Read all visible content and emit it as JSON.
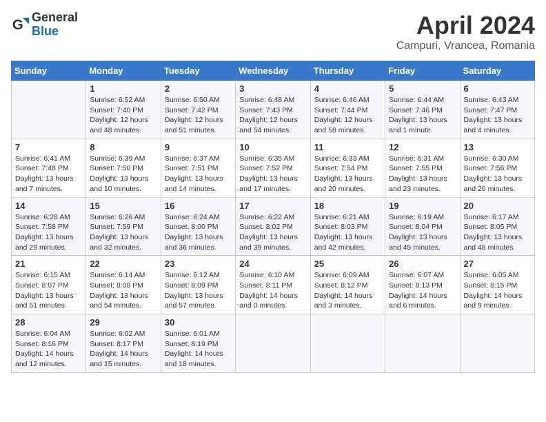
{
  "header": {
    "logo_general": "General",
    "logo_blue": "Blue",
    "month_title": "April 2024",
    "subtitle": "Campuri, Vrancea, Romania"
  },
  "days_of_week": [
    "Sunday",
    "Monday",
    "Tuesday",
    "Wednesday",
    "Thursday",
    "Friday",
    "Saturday"
  ],
  "weeks": [
    [
      {
        "day": "",
        "info": ""
      },
      {
        "day": "1",
        "info": "Sunrise: 6:52 AM\nSunset: 7:40 PM\nDaylight: 12 hours\nand 48 minutes."
      },
      {
        "day": "2",
        "info": "Sunrise: 6:50 AM\nSunset: 7:42 PM\nDaylight: 12 hours\nand 51 minutes."
      },
      {
        "day": "3",
        "info": "Sunrise: 6:48 AM\nSunset: 7:43 PM\nDaylight: 12 hours\nand 54 minutes."
      },
      {
        "day": "4",
        "info": "Sunrise: 6:46 AM\nSunset: 7:44 PM\nDaylight: 12 hours\nand 58 minutes."
      },
      {
        "day": "5",
        "info": "Sunrise: 6:44 AM\nSunset: 7:46 PM\nDaylight: 13 hours\nand 1 minute."
      },
      {
        "day": "6",
        "info": "Sunrise: 6:43 AM\nSunset: 7:47 PM\nDaylight: 13 hours\nand 4 minutes."
      }
    ],
    [
      {
        "day": "7",
        "info": "Sunrise: 6:41 AM\nSunset: 7:48 PM\nDaylight: 13 hours\nand 7 minutes."
      },
      {
        "day": "8",
        "info": "Sunrise: 6:39 AM\nSunset: 7:50 PM\nDaylight: 13 hours\nand 10 minutes."
      },
      {
        "day": "9",
        "info": "Sunrise: 6:37 AM\nSunset: 7:51 PM\nDaylight: 13 hours\nand 14 minutes."
      },
      {
        "day": "10",
        "info": "Sunrise: 6:35 AM\nSunset: 7:52 PM\nDaylight: 13 hours\nand 17 minutes."
      },
      {
        "day": "11",
        "info": "Sunrise: 6:33 AM\nSunset: 7:54 PM\nDaylight: 13 hours\nand 20 minutes."
      },
      {
        "day": "12",
        "info": "Sunrise: 6:31 AM\nSunset: 7:55 PM\nDaylight: 13 hours\nand 23 minutes."
      },
      {
        "day": "13",
        "info": "Sunrise: 6:30 AM\nSunset: 7:56 PM\nDaylight: 13 hours\nand 26 minutes."
      }
    ],
    [
      {
        "day": "14",
        "info": "Sunrise: 6:28 AM\nSunset: 7:58 PM\nDaylight: 13 hours\nand 29 minutes."
      },
      {
        "day": "15",
        "info": "Sunrise: 6:26 AM\nSunset: 7:59 PM\nDaylight: 13 hours\nand 32 minutes."
      },
      {
        "day": "16",
        "info": "Sunrise: 6:24 AM\nSunset: 8:00 PM\nDaylight: 13 hours\nand 36 minutes."
      },
      {
        "day": "17",
        "info": "Sunrise: 6:22 AM\nSunset: 8:02 PM\nDaylight: 13 hours\nand 39 minutes."
      },
      {
        "day": "18",
        "info": "Sunrise: 6:21 AM\nSunset: 8:03 PM\nDaylight: 13 hours\nand 42 minutes."
      },
      {
        "day": "19",
        "info": "Sunrise: 6:19 AM\nSunset: 8:04 PM\nDaylight: 13 hours\nand 45 minutes."
      },
      {
        "day": "20",
        "info": "Sunrise: 6:17 AM\nSunset: 8:05 PM\nDaylight: 13 hours\nand 48 minutes."
      }
    ],
    [
      {
        "day": "21",
        "info": "Sunrise: 6:15 AM\nSunset: 8:07 PM\nDaylight: 13 hours\nand 51 minutes."
      },
      {
        "day": "22",
        "info": "Sunrise: 6:14 AM\nSunset: 8:08 PM\nDaylight: 13 hours\nand 54 minutes."
      },
      {
        "day": "23",
        "info": "Sunrise: 6:12 AM\nSunset: 8:09 PM\nDaylight: 13 hours\nand 57 minutes."
      },
      {
        "day": "24",
        "info": "Sunrise: 6:10 AM\nSunset: 8:11 PM\nDaylight: 14 hours\nand 0 minutes."
      },
      {
        "day": "25",
        "info": "Sunrise: 6:09 AM\nSunset: 8:12 PM\nDaylight: 14 hours\nand 3 minutes."
      },
      {
        "day": "26",
        "info": "Sunrise: 6:07 AM\nSunset: 8:13 PM\nDaylight: 14 hours\nand 6 minutes."
      },
      {
        "day": "27",
        "info": "Sunrise: 6:05 AM\nSunset: 8:15 PM\nDaylight: 14 hours\nand 9 minutes."
      }
    ],
    [
      {
        "day": "28",
        "info": "Sunrise: 6:04 AM\nSunset: 8:16 PM\nDaylight: 14 hours\nand 12 minutes."
      },
      {
        "day": "29",
        "info": "Sunrise: 6:02 AM\nSunset: 8:17 PM\nDaylight: 14 hours\nand 15 minutes."
      },
      {
        "day": "30",
        "info": "Sunrise: 6:01 AM\nSunset: 8:19 PM\nDaylight: 14 hours\nand 18 minutes."
      },
      {
        "day": "",
        "info": ""
      },
      {
        "day": "",
        "info": ""
      },
      {
        "day": "",
        "info": ""
      },
      {
        "day": "",
        "info": ""
      }
    ]
  ]
}
